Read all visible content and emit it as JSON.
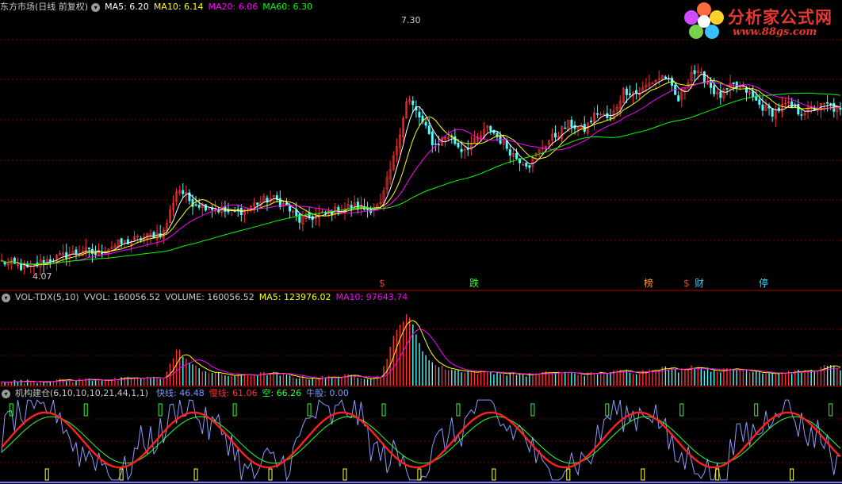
{
  "price_header": {
    "title": "东方市场(日线 前复权)",
    "ma5": "MA5: 6.20",
    "ma10": "MA10: 6.14",
    "ma20": "MA20: 6.06",
    "ma60": "MA60: 6.30"
  },
  "volume_header": {
    "title": "VOL-TDX(5,10)",
    "vvol": "VVOL: 160056.52",
    "volume": "VOLUME: 160056.52",
    "ma5": "MA5: 123976.02",
    "ma10": "MA10: 97643.74"
  },
  "indicator_header": {
    "title": "机构建仓(6,10,10,10,21,44,1,1)",
    "fast": "快线: 46.48",
    "slow": "慢线: 61.06",
    "empty": "空: 66.26",
    "bull": "牛股: 0.00"
  },
  "price_annotations": {
    "high": "7.30",
    "low": "4.07"
  },
  "event_markers": [
    {
      "label": "$",
      "color": "#ff3030"
    },
    {
      "label": "跌",
      "color": "#30ff30"
    },
    {
      "label": "榜",
      "color": "#ff9a30"
    },
    {
      "label": "$",
      "color": "#ff3030"
    },
    {
      "label": "财",
      "color": "#30c8ff"
    },
    {
      "label": "停",
      "color": "#30e0ff"
    }
  ],
  "logo": {
    "title": "分析家公式网",
    "url": "www.88gs.com"
  },
  "colors": {
    "up": "#ff3232",
    "down": "#54fcfc",
    "ma5": "#ffffff",
    "ma10": "#ffff00",
    "ma20": "#ff00ff",
    "ma60": "#00ff00",
    "grid": "#7a0000"
  },
  "chart_data": {
    "type": "candlestick",
    "price_range": [
      4.07,
      7.3
    ],
    "price_path": [
      4.2,
      4.15,
      4.1,
      4.2,
      4.25,
      4.3,
      4.35,
      4.3,
      4.4,
      4.45,
      4.5,
      4.55,
      4.6,
      5.2,
      5.0,
      4.95,
      4.9,
      4.85,
      4.9,
      5.0,
      5.05,
      4.95,
      4.75,
      4.8,
      4.85,
      4.9,
      4.95,
      4.9,
      4.95,
      5.6,
      6.4,
      6.1,
      5.75,
      5.9,
      5.7,
      5.8,
      6.0,
      5.8,
      5.6,
      5.5,
      5.75,
      5.9,
      6.05,
      5.95,
      6.2,
      6.1,
      6.5,
      6.45,
      6.6,
      6.7,
      6.35,
      6.75,
      6.65,
      6.4,
      6.55,
      6.5,
      6.3,
      6.2,
      6.3,
      6.2,
      6.25,
      6.3,
      6.2
    ],
    "volume_path": [
      0.06,
      0.05,
      0.05,
      0.06,
      0.07,
      0.06,
      0.07,
      0.08,
      0.07,
      0.08,
      0.09,
      0.09,
      0.1,
      0.45,
      0.25,
      0.18,
      0.14,
      0.12,
      0.13,
      0.14,
      0.15,
      0.12,
      0.1,
      0.09,
      0.1,
      0.11,
      0.12,
      0.1,
      0.11,
      0.6,
      0.9,
      0.45,
      0.25,
      0.2,
      0.18,
      0.16,
      0.17,
      0.15,
      0.14,
      0.13,
      0.15,
      0.16,
      0.15,
      0.14,
      0.15,
      0.16,
      0.18,
      0.16,
      0.2,
      0.22,
      0.18,
      0.24,
      0.2,
      0.18,
      0.2,
      0.19,
      0.17,
      0.15,
      0.16,
      0.17,
      0.18,
      0.24,
      0.2
    ]
  }
}
